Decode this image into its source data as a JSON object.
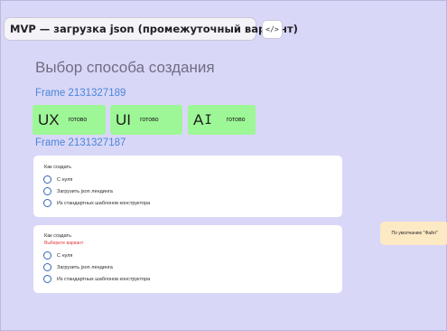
{
  "page": {
    "title": "MVP — загрузка json (промежуточный вариант)",
    "code_button_glyph": "</>"
  },
  "main": {
    "heading": "Выбор способа создания",
    "frame_label_1": "Frame 2131327189",
    "frame_label_2": "Frame 2131327187",
    "chips": [
      {
        "label": "UX",
        "status": "готово"
      },
      {
        "label": "UI",
        "status": "готово"
      },
      {
        "label": "A",
        "status": "готово"
      }
    ],
    "cards": [
      {
        "question": "Как создать",
        "error": "",
        "options": [
          "С нуля",
          "Загрузить json лендинга",
          "Из стандартных шаблонов конструктора"
        ]
      },
      {
        "question": "Как создать",
        "error": "Выберите вариант",
        "options": [
          "С нуля",
          "Загрузить json лендинга",
          "Из стандартных шаблонов конструктора"
        ]
      }
    ]
  },
  "sticky_note": {
    "text": "По умолчанию \"Файл\""
  },
  "colors": {
    "canvas": "#d9d7f7",
    "chip": "#9df796",
    "link": "#4a86d8",
    "error": "#e03a3a",
    "radio": "#3266b8",
    "note": "#fde9c3"
  },
  "icons": {
    "code": "code-icon",
    "cursor": "text-cursor-icon",
    "radio": "radio-unchecked-icon"
  }
}
